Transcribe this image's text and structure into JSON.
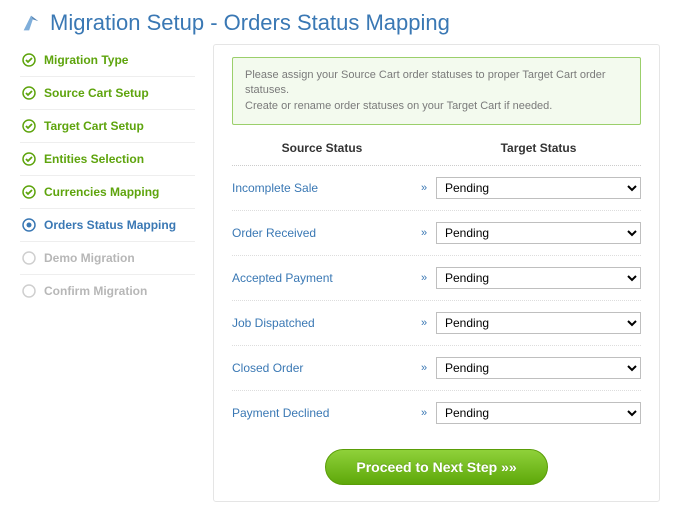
{
  "header": {
    "title": "Migration Setup - Orders Status Mapping"
  },
  "sidebar": {
    "items": [
      {
        "label": "Migration Type",
        "state": "done"
      },
      {
        "label": "Source Cart Setup",
        "state": "done"
      },
      {
        "label": "Target Cart Setup",
        "state": "done"
      },
      {
        "label": "Entities Selection",
        "state": "done"
      },
      {
        "label": "Currencies Mapping",
        "state": "done"
      },
      {
        "label": "Orders Status Mapping",
        "state": "current"
      },
      {
        "label": "Demo Migration",
        "state": "future"
      },
      {
        "label": "Confirm Migration",
        "state": "future"
      }
    ]
  },
  "main": {
    "info_line1": "Please assign your Source Cart order statuses to proper Target Cart order statuses.",
    "info_line2": "Create or rename order statuses on your Target Cart if needed.",
    "columns": {
      "source": "Source Status",
      "target": "Target Status"
    },
    "arrow_glyph": "»",
    "rows": [
      {
        "source": "Incomplete Sale",
        "target": "Pending"
      },
      {
        "source": "Order Received",
        "target": "Pending"
      },
      {
        "source": "Accepted Payment",
        "target": "Pending"
      },
      {
        "source": "Job Dispatched",
        "target": "Pending"
      },
      {
        "source": "Closed Order",
        "target": "Pending"
      },
      {
        "source": "Payment Declined",
        "target": "Pending"
      }
    ],
    "proceed_label": "Proceed to Next Step »»"
  }
}
